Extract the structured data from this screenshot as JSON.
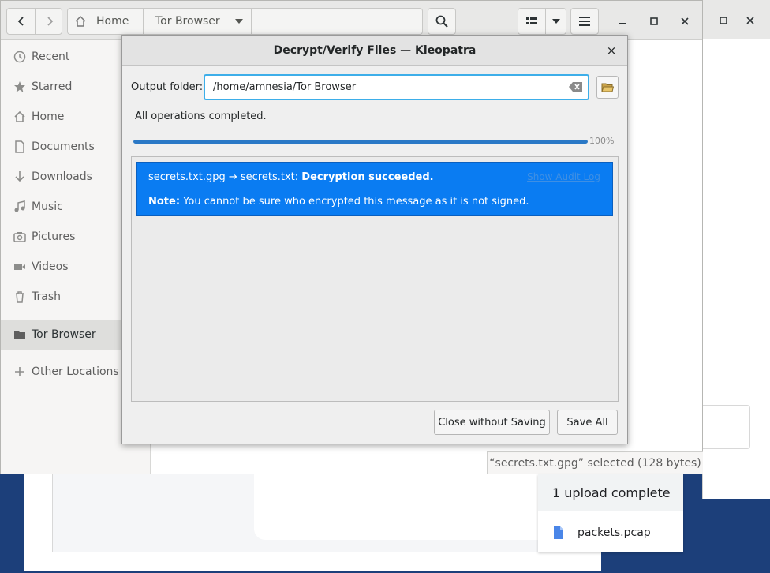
{
  "file_manager": {
    "breadcrumbs": [
      "Home",
      "Tor Browser"
    ],
    "sidebar": [
      {
        "label": "Recent",
        "icon": "clock-icon"
      },
      {
        "label": "Starred",
        "icon": "star-icon"
      },
      {
        "label": "Home",
        "icon": "home-icon"
      },
      {
        "label": "Documents",
        "icon": "document-icon"
      },
      {
        "label": "Downloads",
        "icon": "download-icon"
      },
      {
        "label": "Music",
        "icon": "music-icon"
      },
      {
        "label": "Pictures",
        "icon": "camera-icon"
      },
      {
        "label": "Videos",
        "icon": "video-icon"
      },
      {
        "label": "Trash",
        "icon": "trash-icon"
      },
      {
        "label": "Tor Browser",
        "icon": "folder-icon"
      },
      {
        "label": "Other Locations",
        "icon": "plus-icon"
      }
    ],
    "status": "“secrets.txt.gpg” selected  (128 bytes)"
  },
  "dialog": {
    "title": "Decrypt/Verify Files — Kleopatra",
    "close_glyph": "×",
    "output_label": "Output folder:",
    "output_value": "/home/amnesia/Tor Browser",
    "ops_status": "All operations completed.",
    "progress_percent": 100,
    "progress_label": "100%",
    "result": {
      "file_text": "secrets.txt.gpg → secrets.txt: ",
      "status_text": "Decryption succeeded.",
      "audit_link": "Show Audit Log",
      "note_label": "Note:",
      "note_text": " You cannot be sure who encrypted this message as it is not signed."
    },
    "buttons": {
      "close_without_saving": "Close without Saving",
      "save_all": "Save All"
    }
  },
  "upload_popup": {
    "title": "1 upload complete",
    "file": "packets.pcap"
  },
  "colors": {
    "accent": "#3daee9",
    "result_bg": "#0a7cf2",
    "progress": "#2a78c6",
    "desktop": "#1c3f7a"
  }
}
